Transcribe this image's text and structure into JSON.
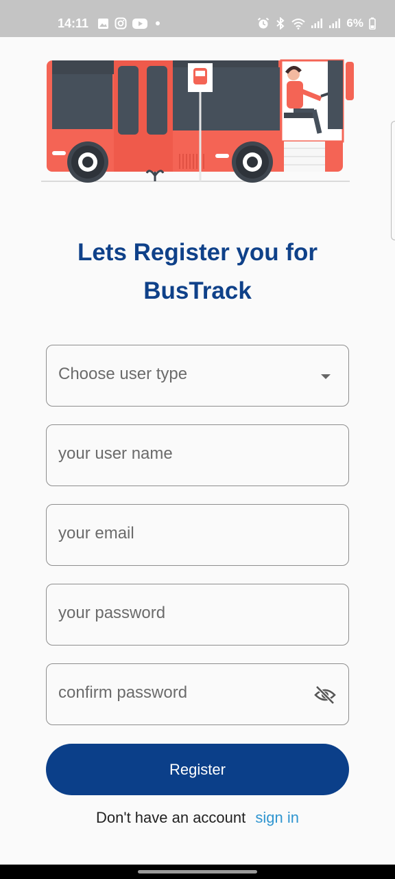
{
  "status_bar": {
    "time": "14:11",
    "left_icons": [
      "gallery-icon",
      "instagram-icon",
      "youtube-icon",
      "dot-icon"
    ],
    "right_icons": [
      "alarm-icon",
      "bluetooth-icon",
      "wifi-icon",
      "signal-icon",
      "signal-icon-2"
    ],
    "battery": "6%"
  },
  "title": {
    "line1": "Lets Register you for",
    "line2": "BusTrack"
  },
  "form": {
    "user_type_placeholder": "Choose user type",
    "username_placeholder": "your user name",
    "email_placeholder": "your email",
    "password_placeholder": "your password",
    "confirm_placeholder": "confirm password"
  },
  "register_label": "Register",
  "footer": {
    "prompt": "Don't have an account",
    "link": "sign in"
  },
  "colors": {
    "primary": "#0b3f89",
    "title": "#0f4189",
    "link": "#2f95d0",
    "bus": "#f46455"
  }
}
